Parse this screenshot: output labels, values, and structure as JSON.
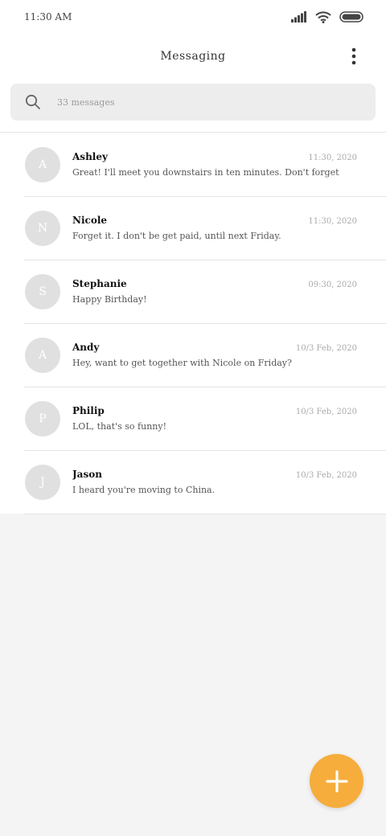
{
  "status_bar": {
    "time": "11:30 AM"
  },
  "header": {
    "title": "Messaging"
  },
  "search": {
    "placeholder": "33 messages"
  },
  "conversations": [
    {
      "initial": "A",
      "name": "Ashley",
      "time": "11:30, 2020",
      "message": "Great! I'll meet you downstairs in ten minutes. Don't forget"
    },
    {
      "initial": "N",
      "name": "Nicole",
      "time": "11:30, 2020",
      "message": "Forget it. I don't be get paid, until next Friday."
    },
    {
      "initial": "S",
      "name": "Stephanie",
      "time": "09:30, 2020",
      "message": "Happy Birthday!"
    },
    {
      "initial": "A",
      "name": "Andy",
      "time": "10/3 Feb, 2020",
      "message": "Hey, want to get together with Nicole on Friday?"
    },
    {
      "initial": "P",
      "name": "Philip",
      "time": "10/3 Feb, 2020",
      "message": "LOL, that's so funny!"
    },
    {
      "initial": "J",
      "name": "Jason",
      "time": "10/3 Feb, 2020",
      "message": "I heard you're moving to China."
    }
  ],
  "colors": {
    "fab": "#f6ad3c",
    "avatar": "#e0e0e0"
  },
  "icons": {
    "menu": "more-vert-icon",
    "search": "search-icon",
    "fab": "plus-icon"
  }
}
